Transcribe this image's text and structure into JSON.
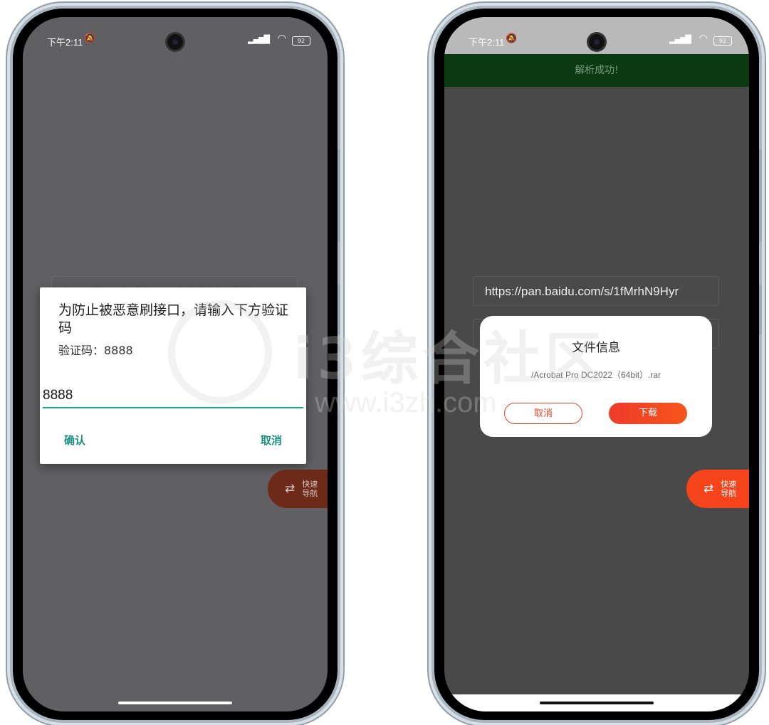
{
  "left_phone": {
    "status": {
      "time": "下午2:11",
      "battery": "92"
    },
    "url_text": "https://pan.baidu.com/s/1fMrhN9Hyr",
    "dialog": {
      "title": "为防止被恶意刷接口，请输入下方验证码",
      "code_text": "验证码：8888",
      "input_value": "8888",
      "confirm_label": "确认",
      "cancel_label": "取消"
    },
    "fab": {
      "label": "快速导航"
    }
  },
  "right_phone": {
    "status": {
      "time": "下午2:11",
      "battery": "92"
    },
    "toast": "解析成功!",
    "url_text": "https://pan.baidu.com/s/1fMrhN9Hyr",
    "file_dialog": {
      "title": "文件信息",
      "file_name": "/Acrobat Pro DC2022（64bit）.rar",
      "cancel_label": "取消",
      "download_label": "下载"
    },
    "fab": {
      "label": "快速导航"
    }
  },
  "watermark": {
    "brand": "i3综合社区",
    "url": "www.i3zh.com"
  },
  "icons": [
    "bell-off-icon",
    "signal-icon",
    "wifi-icon",
    "battery-icon",
    "camera-icon",
    "swap-icon"
  ]
}
